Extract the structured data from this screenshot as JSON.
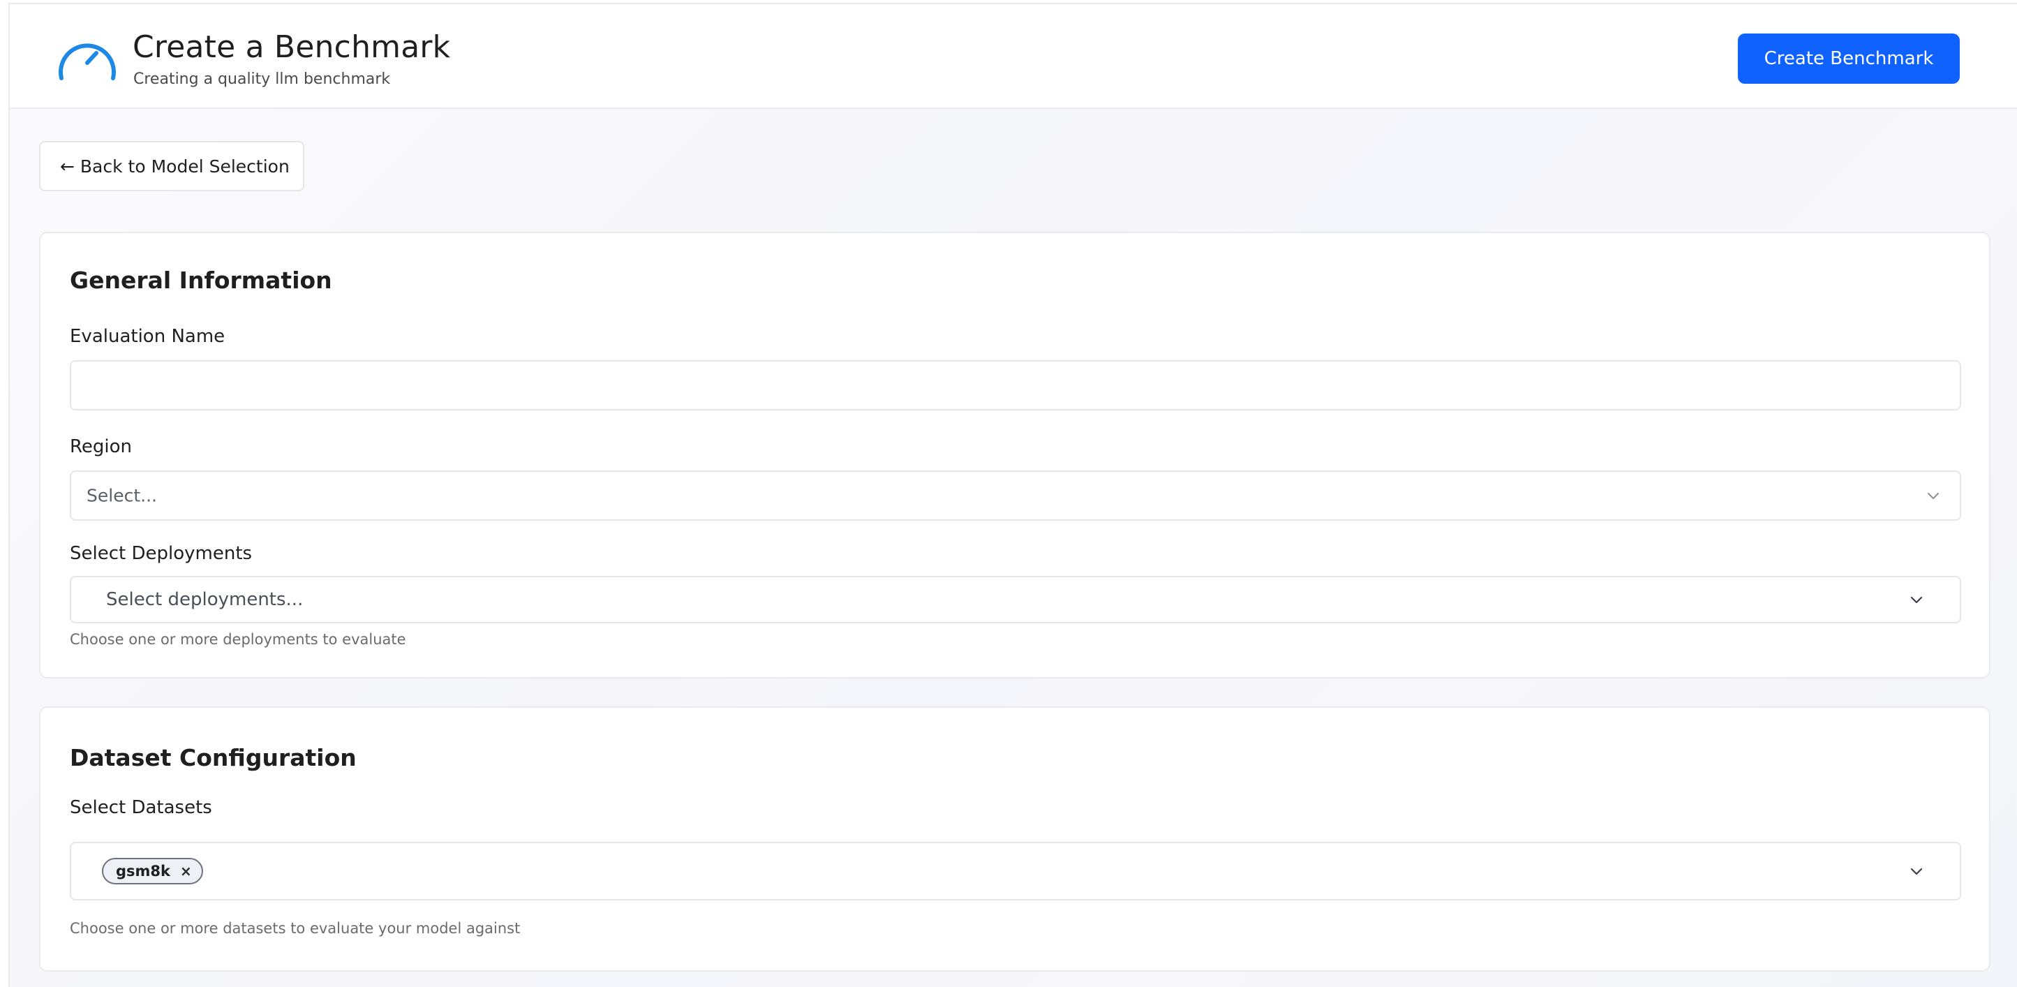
{
  "header": {
    "title": "Create a Benchmark",
    "subtitle": "Creating a quality llm benchmark",
    "logo_icon": "speedometer-icon",
    "primary_button_label": "Create Benchmark",
    "accent_color": "#0f62fe"
  },
  "back_button": {
    "label": "← Back to Model Selection"
  },
  "general_info": {
    "title": "General Information",
    "evaluation_name": {
      "label": "Evaluation Name",
      "value": "",
      "placeholder": ""
    },
    "region": {
      "label": "Region",
      "placeholder": "Select...",
      "icon": "chevron-down-icon"
    },
    "deployments": {
      "label": "Select Deployments",
      "placeholder": "Select deployments...",
      "helper": "Choose one or more deployments to evaluate",
      "icon": "chevron-down-icon"
    }
  },
  "dataset_config": {
    "title": "Dataset Configuration",
    "datasets": {
      "label": "Select Datasets",
      "selected": [
        "gsm8k"
      ],
      "remove_glyph": "×",
      "helper": "Choose one or more datasets to evaluate your model against",
      "icon": "chevron-down-icon"
    }
  }
}
